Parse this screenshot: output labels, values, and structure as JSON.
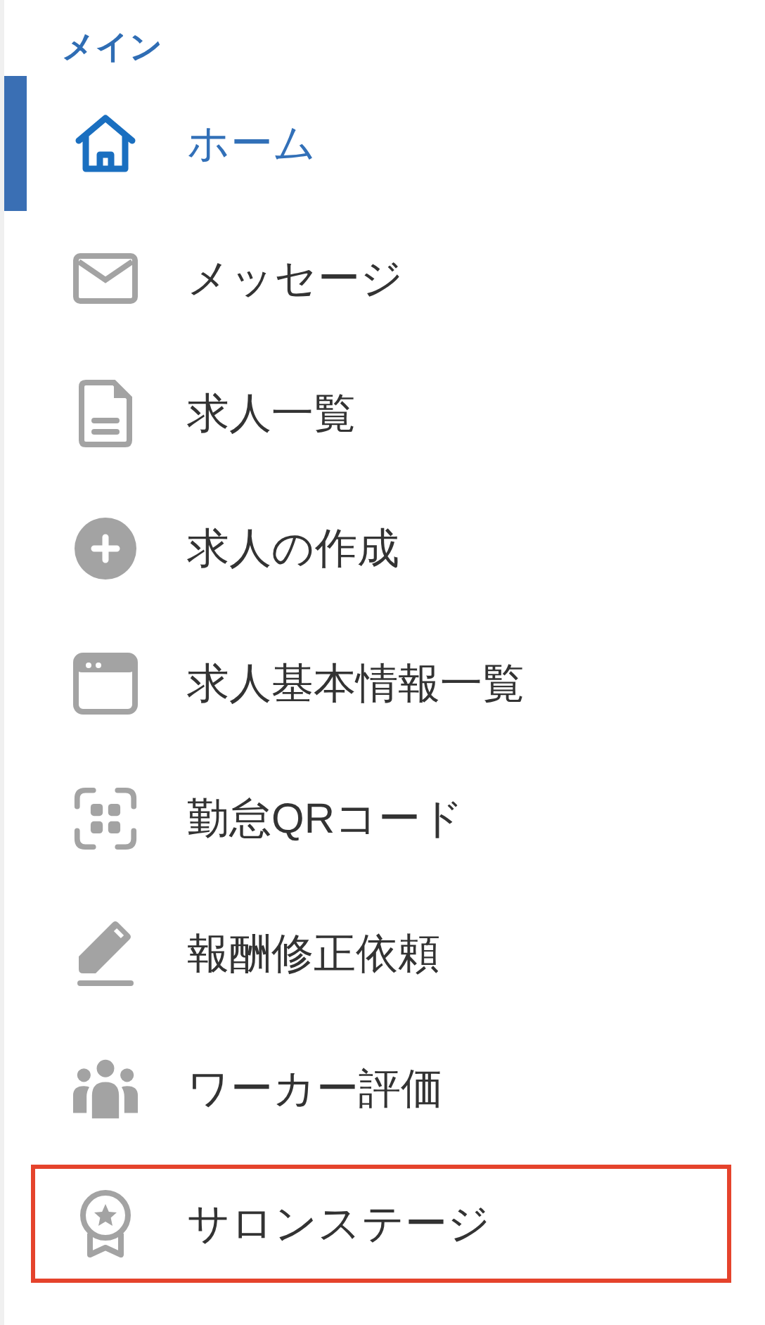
{
  "section": {
    "title": "メイン"
  },
  "menu_items": [
    {
      "label": "ホーム",
      "selected": true,
      "highlighted": false
    },
    {
      "label": "メッセージ",
      "selected": false,
      "highlighted": false
    },
    {
      "label": "求人一覧",
      "selected": false,
      "highlighted": false
    },
    {
      "label": "求人の作成",
      "selected": false,
      "highlighted": false
    },
    {
      "label": "求人基本情報一覧",
      "selected": false,
      "highlighted": false
    },
    {
      "label": "勤怠QRコード",
      "selected": false,
      "highlighted": false
    },
    {
      "label": "報酬修正依頼",
      "selected": false,
      "highlighted": false
    },
    {
      "label": "ワーカー評価",
      "selected": false,
      "highlighted": false
    },
    {
      "label": "サロンステージ",
      "selected": false,
      "highlighted": true
    }
  ]
}
